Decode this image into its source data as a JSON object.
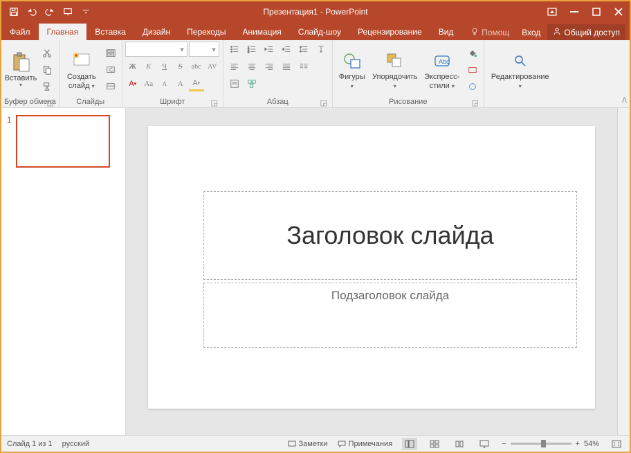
{
  "window_title": "Презентация1 - PowerPoint",
  "tabs": {
    "file": "Файл",
    "home": "Главная",
    "insert": "Вставка",
    "design": "Дизайн",
    "transitions": "Переходы",
    "animations": "Анимация",
    "slideshow": "Слайд-шоу",
    "review": "Рецензирование",
    "view": "Вид"
  },
  "tabrow_right": {
    "tellme": "Помощ",
    "signin": "Вход",
    "share": "Общий доступ"
  },
  "ribbon": {
    "clipboard": {
      "label": "Буфер обмена",
      "paste": "Вставить"
    },
    "slides": {
      "label": "Слайды",
      "newslide1": "Создать",
      "newslide2": "слайд"
    },
    "font": {
      "label": "Шрифт"
    },
    "paragraph": {
      "label": "Абзац"
    },
    "drawing": {
      "label": "Рисование",
      "shapes": "Фигуры",
      "arrange": "Упорядочить",
      "quickstyles1": "Экспресс-",
      "quickstyles2": "стили"
    },
    "editing": {
      "label": "Редактирование"
    }
  },
  "slide": {
    "number": "1",
    "title_placeholder": "Заголовок слайда",
    "subtitle_placeholder": "Подзаголовок слайда"
  },
  "statusbar": {
    "slide_of": "Слайд 1 из 1",
    "language": "русский",
    "notes": "Заметки",
    "comments": "Примечания",
    "zoom": "54%"
  },
  "font_glyphs": {
    "b": "Ж",
    "i": "К",
    "u": "Ч",
    "s": "S",
    "shadow": "abc",
    "av": "AV",
    "Afont": "A",
    "Aa": "Aa",
    "Asmall": "A",
    "Abig": "A",
    "Acolor": "A"
  }
}
